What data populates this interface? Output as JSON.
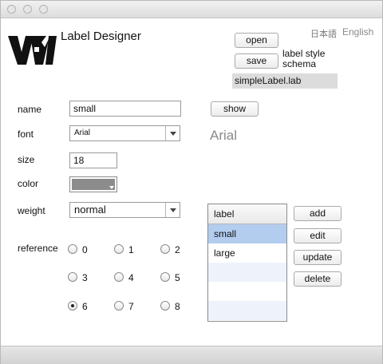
{
  "app": {
    "title": "Label Designer"
  },
  "languages": [
    "日本語",
    "English"
  ],
  "file": {
    "open_label": "open",
    "save_label": "save",
    "type_line1": "label style",
    "type_line2": "schema",
    "filename": "simpleLabel.lab"
  },
  "form": {
    "name_label": "name",
    "name_value": "small",
    "show_label": "show",
    "font_label": "font",
    "font_value": "Arial",
    "font_preview": "Arial",
    "size_label": "size",
    "size_value": "18",
    "color_label": "color",
    "color_value": "#8c8c8c",
    "weight_label": "weight",
    "weight_value": "normal",
    "reference_label": "reference",
    "reference_options": [
      "0",
      "1",
      "2",
      "3",
      "4",
      "5",
      "6",
      "7",
      "8"
    ],
    "reference_selected": "6"
  },
  "list": {
    "header": "label",
    "items": [
      "small",
      "large"
    ],
    "selected": "small"
  },
  "actions": {
    "add": "add",
    "edit": "edit",
    "update": "update",
    "delete": "delete"
  },
  "colors": {
    "selection": "#b3cdef",
    "alt_row": "#eef3fb"
  }
}
